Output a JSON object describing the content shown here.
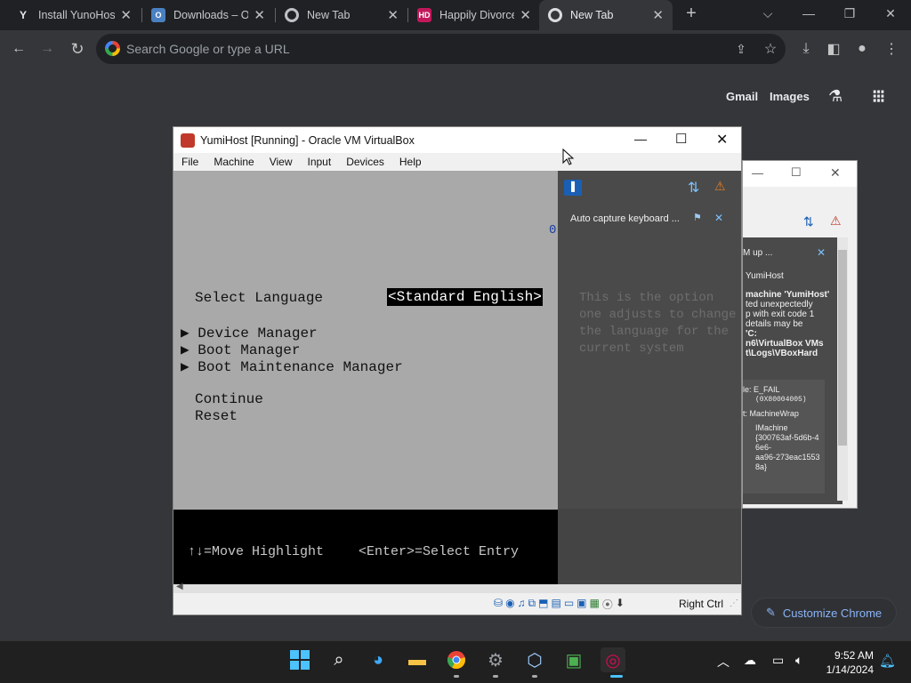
{
  "chrome": {
    "tabs": [
      {
        "title": "Install YunoHost",
        "favicon": "yunohost-icon",
        "color": "#202124"
      },
      {
        "title": "Downloads – Ora",
        "favicon": "oracle-icon",
        "color": "#1a73e8"
      },
      {
        "title": "New Tab",
        "favicon": "chrome-icon",
        "color": "#5f6368"
      },
      {
        "title": "Happily Divorced",
        "favicon": "hd-icon",
        "color": "#c2185b"
      },
      {
        "title": "New Tab",
        "favicon": "chrome-icon",
        "color": "#5f6368",
        "active": true
      }
    ],
    "omnibox_placeholder": "Search Google or type a URL",
    "ntp_links": {
      "gmail": "Gmail",
      "images": "Images"
    },
    "customize_label": "Customize Chrome"
  },
  "virtualbox": {
    "title": "YumiHost [Running] - Oracle VM VirtualBox",
    "menu": [
      "File",
      "Machine",
      "View",
      "Input",
      "Devices",
      "Help"
    ],
    "status_host_key": "Right Ctrl",
    "notification": {
      "text": "Auto capture keyboard ..."
    }
  },
  "uefi": {
    "zero_marker": "0",
    "select_language_label": "Select Language",
    "select_language_value": "<Standard English>",
    "menu_items": [
      "Device Manager",
      "Boot Manager",
      "Boot Maintenance Manager"
    ],
    "actions": [
      "Continue",
      "Reset"
    ],
    "help_text": [
      "This is the option",
      "one adjusts to change",
      "the language for the",
      "current system"
    ],
    "footer_move": "↑↓=Move Highlight",
    "footer_enter": "<Enter>=Select Entry"
  },
  "bg_window": {
    "notif_title": "M up ...",
    "lines": [
      "YumiHost",
      "machine 'YumiHost'",
      "ted unexpectedly",
      "p with exit code 1",
      "details may be",
      "'C:",
      "n6\\VirtualBox VMs",
      "t\\Logs\\VBoxHard"
    ],
    "details": [
      {
        "label": "le:",
        "value": "E_FAIL"
      },
      {
        "label": "",
        "value": "(0X80004005)"
      },
      {
        "label": "t:",
        "value": "MachineWrap"
      },
      {
        "label": "",
        "value": "IMachine"
      },
      {
        "label": "",
        "value": "{300763af-5d6b-4"
      },
      {
        "label": "",
        "value": "6e6-"
      },
      {
        "label": "",
        "value": "aa96-273eac1553"
      },
      {
        "label": "",
        "value": "8a}"
      }
    ]
  },
  "taskbar": {
    "clock_time": "9:52 AM",
    "clock_date": "1/14/2024",
    "apps": [
      "windows-start-icon",
      "search-icon",
      "edge-beta-icon",
      "file-explorer-icon",
      "chrome-icon",
      "settings-icon",
      "virtualbox-icon",
      "terminal-icon",
      "debian-icon"
    ]
  }
}
